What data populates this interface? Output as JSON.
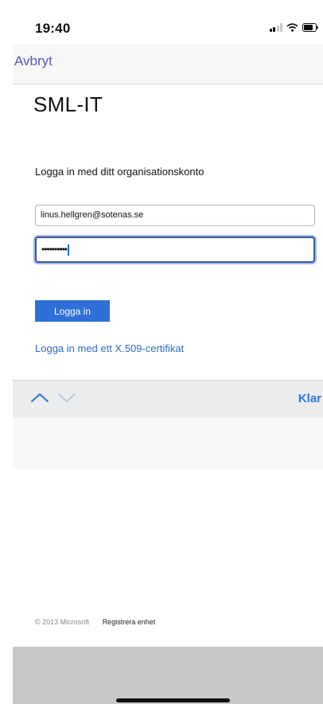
{
  "status_bar": {
    "time": "19:40",
    "icons": [
      "signal-icon",
      "wifi-icon",
      "battery-icon"
    ]
  },
  "nav": {
    "cancel_label": "Avbryt"
  },
  "form": {
    "title": "SML-IT",
    "subtitle": "Logga in med ditt organisationskonto",
    "email_value": "linus.hellgren@sotenas.se",
    "password_masked": "••••••••••",
    "login_label": "Logga in",
    "cert_link": "Logga in med ett X.509-certifikat"
  },
  "keyboard_accessory": {
    "prev_icon": "chevron-up-icon",
    "next_icon": "chevron-down-icon",
    "done_label": "Klar"
  },
  "footer": {
    "copyright": "© 2013 Microsoft",
    "register_link": "Registrera enhet"
  },
  "colors": {
    "accent": "#2f6fd8",
    "link": "#2b6cc4",
    "cancel": "#5a58c8"
  }
}
